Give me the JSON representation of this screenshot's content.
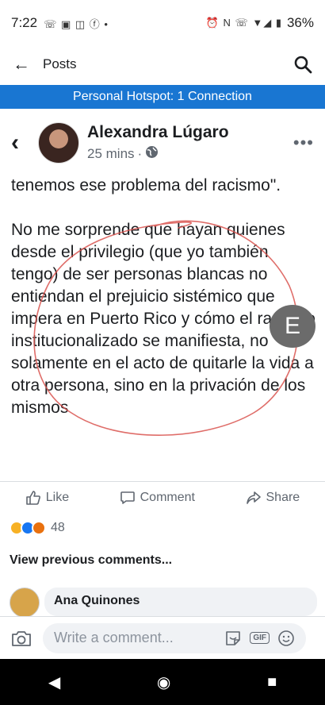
{
  "status_bar": {
    "time": "7:22",
    "notification_icons": "☏ ▣ ◫ ⓕ •",
    "system_icons": "⏰ N ☏ ▼◢ ▮",
    "battery": "36%"
  },
  "header": {
    "back_icon": "arrow-left-icon",
    "title": "Posts",
    "search_icon": "search-icon"
  },
  "hotspot_banner": "Personal Hotspot: 1 Connection",
  "post": {
    "author": "Alexandra Lúgaro",
    "time": "25 mins",
    "separator": "·",
    "audience_icon": "globe-icon",
    "more": "•••",
    "paragraph_1": "tenemos ese problema del racismo\".",
    "paragraph_2": "No me sorprende que hayan quienes desde el privilegio (que yo también tengo) de ser personas blancas no entiendan el prejuicio sistémico que impera en Puerto Rico y cómo el racismo institucionalizado se manifiesta, no solamente en el acto de quitarle la vida a otra persona, sino en la privación de los mismos",
    "floating_button_letter": "E"
  },
  "actions": {
    "like": "Like",
    "comment": "Comment",
    "share": "Share"
  },
  "reactions": {
    "count": "48",
    "colors": {
      "haha": "#f7b125",
      "like": "#1877f2",
      "angry": "#e9710f"
    }
  },
  "view_previous": "View previous comments...",
  "comment": {
    "author": "Ana Quinones"
  },
  "composer": {
    "placeholder": "Write a comment...",
    "gif_label": "GIF"
  },
  "nav": {
    "back": "◀",
    "home": "◉",
    "recents": "■"
  },
  "colors": {
    "hotspot_blue": "#1976d2",
    "scribble_red": "#d9534f"
  }
}
